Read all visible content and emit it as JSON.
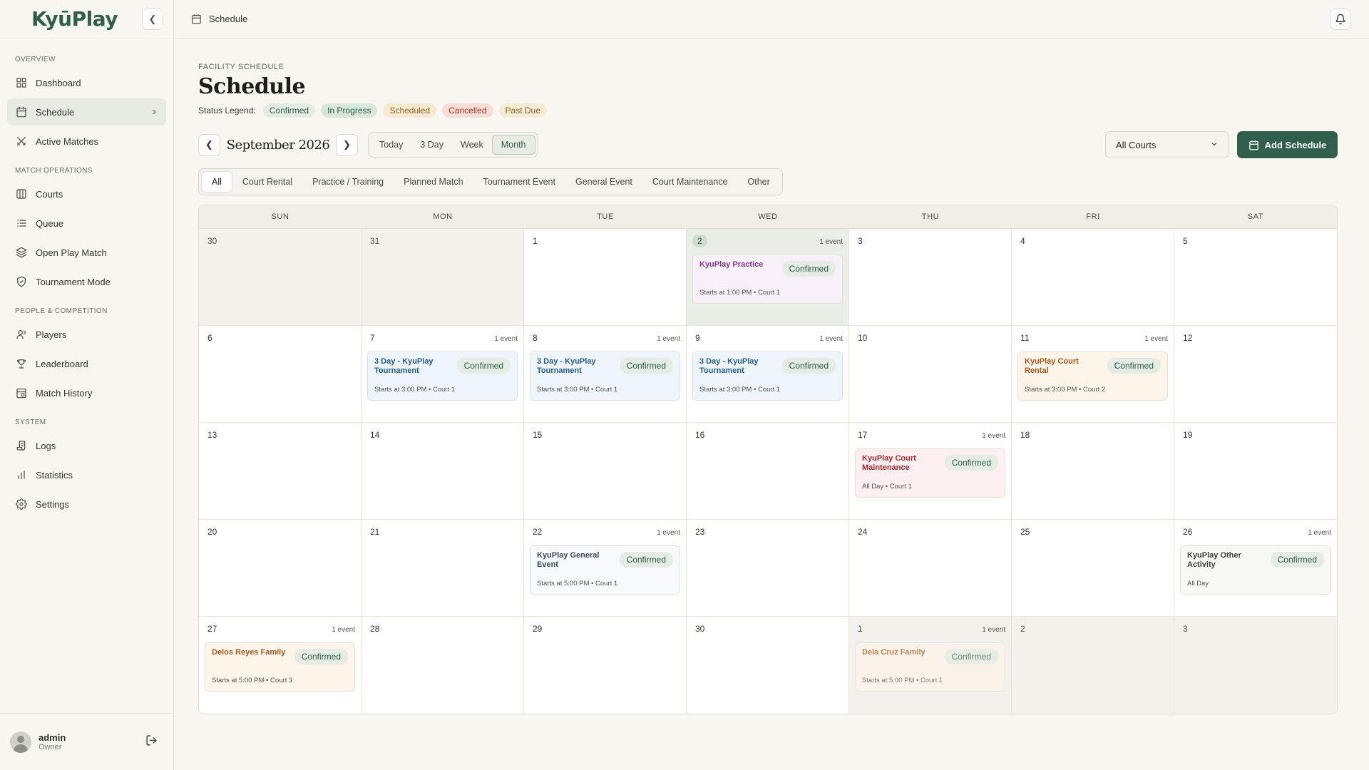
{
  "app": {
    "logo": "KyūPlay"
  },
  "sidebar": {
    "sections": [
      {
        "title": "OVERVIEW",
        "items": [
          {
            "label": "Dashboard",
            "icon": "grid-icon"
          },
          {
            "label": "Schedule",
            "icon": "calendar-icon",
            "active": true
          },
          {
            "label": "Active Matches",
            "icon": "swords-icon"
          }
        ]
      },
      {
        "title": "MATCH OPERATIONS",
        "items": [
          {
            "label": "Courts",
            "icon": "columns-icon"
          },
          {
            "label": "Queue",
            "icon": "list-icon"
          },
          {
            "label": "Open Play Match",
            "icon": "layers-icon"
          },
          {
            "label": "Tournament Mode",
            "icon": "shield-icon"
          }
        ]
      },
      {
        "title": "PEOPLE & COMPETITION",
        "items": [
          {
            "label": "Players",
            "icon": "users-icon"
          },
          {
            "label": "Leaderboard",
            "icon": "trophy-icon"
          },
          {
            "label": "Match History",
            "icon": "history-icon"
          }
        ]
      },
      {
        "title": "SYSTEM",
        "items": [
          {
            "label": "Logs",
            "icon": "scroll-icon"
          },
          {
            "label": "Statistics",
            "icon": "bar-chart-icon"
          },
          {
            "label": "Settings",
            "icon": "gear-icon"
          }
        ]
      }
    ],
    "user": {
      "name": "admin",
      "role": "Owner"
    }
  },
  "topbar": {
    "breadcrumb": "Schedule"
  },
  "page": {
    "eyebrow": "FACILITY SCHEDULE",
    "title": "Schedule",
    "legend_label": "Status Legend:",
    "legend": [
      {
        "label": "Confirmed",
        "bg": "#e4ece3",
        "fg": "#2f5e4a"
      },
      {
        "label": "In Progress",
        "bg": "#d9e6dc",
        "fg": "#2f5e4a"
      },
      {
        "label": "Scheduled",
        "bg": "#f6ead2",
        "fg": "#8a6422"
      },
      {
        "label": "Cancelled",
        "bg": "#f6ddd6",
        "fg": "#a2392b"
      },
      {
        "label": "Past Due",
        "bg": "#f5ecd6",
        "fg": "#8a6422"
      }
    ]
  },
  "toolbar": {
    "month": "September 2026",
    "views": [
      "Today",
      "3 Day",
      "Week",
      "Month"
    ],
    "active_view": "Month",
    "court_select": "All Courts",
    "add_label": "Add Schedule"
  },
  "filters": {
    "items": [
      "All",
      "Court Rental",
      "Practice / Training",
      "Planned Match",
      "Tournament Event",
      "General Event",
      "Court Maintenance",
      "Other"
    ],
    "active": "All"
  },
  "calendar": {
    "weekdays": [
      "SUN",
      "MON",
      "TUE",
      "WED",
      "THU",
      "FRI",
      "SAT"
    ],
    "days": [
      {
        "num": "30",
        "muted": true
      },
      {
        "num": "31",
        "muted": true
      },
      {
        "num": "1"
      },
      {
        "num": "2",
        "today": true,
        "highlight": true,
        "count": "1 event",
        "event": {
          "title": "KyuPlay Practice",
          "status": "Confirmed",
          "meta": "Starts at 1:00 PM • Court 1",
          "bg": "#f8f0f8",
          "fg": "#7d3b86"
        }
      },
      {
        "num": "3"
      },
      {
        "num": "4"
      },
      {
        "num": "5"
      },
      {
        "num": "6"
      },
      {
        "num": "7",
        "count": "1 event",
        "event": {
          "title": "3 Day - KyuPlay Tournament",
          "status": "Confirmed",
          "meta": "Starts at 3:00 PM • Court 1",
          "bg": "#eef5fb",
          "fg": "#245d8a"
        }
      },
      {
        "num": "8",
        "count": "1 event",
        "event": {
          "title": "3 Day - KyuPlay Tournament",
          "status": "Confirmed",
          "meta": "Starts at 3:00 PM • Court 1",
          "bg": "#eef5fb",
          "fg": "#245d8a"
        }
      },
      {
        "num": "9",
        "count": "1 event",
        "event": {
          "title": "3 Day - KyuPlay Tournament",
          "status": "Confirmed",
          "meta": "Starts at 3:00 PM • Court 1",
          "bg": "#eef5fb",
          "fg": "#245d8a"
        }
      },
      {
        "num": "10"
      },
      {
        "num": "11",
        "count": "1 event",
        "event": {
          "title": "KyuPlay Court Rental",
          "status": "Confirmed",
          "meta": "Starts at 3:00 PM • Court 2",
          "bg": "#fdf4ea",
          "fg": "#a45a1e"
        }
      },
      {
        "num": "12"
      },
      {
        "num": "13"
      },
      {
        "num": "14"
      },
      {
        "num": "15"
      },
      {
        "num": "16"
      },
      {
        "num": "17",
        "count": "1 event",
        "event": {
          "title": "KyuPlay Court Maintenance",
          "status": "Confirmed",
          "meta": "All Day • Court 1",
          "bg": "#fcefef",
          "fg": "#a02b33"
        }
      },
      {
        "num": "18"
      },
      {
        "num": "19"
      },
      {
        "num": "20"
      },
      {
        "num": "21"
      },
      {
        "num": "22",
        "count": "1 event",
        "event": {
          "title": "KyuPlay General Event",
          "status": "Confirmed",
          "meta": "Starts at 5:00 PM • Court 1",
          "bg": "#f7f9fb",
          "fg": "#3c4a57"
        }
      },
      {
        "num": "23"
      },
      {
        "num": "24"
      },
      {
        "num": "25"
      },
      {
        "num": "26",
        "count": "1 event",
        "event": {
          "title": "KyuPlay Other Activity",
          "status": "Confirmed",
          "meta": "All Day",
          "bg": "#f8f8f6",
          "fg": "#3e3e3a"
        }
      },
      {
        "num": "27",
        "last": true,
        "count": "1 event",
        "event": {
          "title": "Delos Reyes Family",
          "status": "Confirmed",
          "meta": "Starts at 5:00 PM • Court 3",
          "bg": "#fdf4ea",
          "fg": "#a45a1e"
        }
      },
      {
        "num": "28",
        "last": true
      },
      {
        "num": "29",
        "last": true
      },
      {
        "num": "30",
        "last": true
      },
      {
        "num": "1",
        "last": true,
        "muted": true,
        "count": "1 event",
        "faded": true,
        "event": {
          "title": "Dela Cruz Family",
          "status": "Confirmed",
          "meta": "Starts at 5:00 PM • Court 1",
          "bg": "#fdf4ea",
          "fg": "#a45a1e"
        }
      },
      {
        "num": "2",
        "last": true,
        "muted": true
      },
      {
        "num": "3",
        "last": true,
        "muted": true
      }
    ]
  }
}
